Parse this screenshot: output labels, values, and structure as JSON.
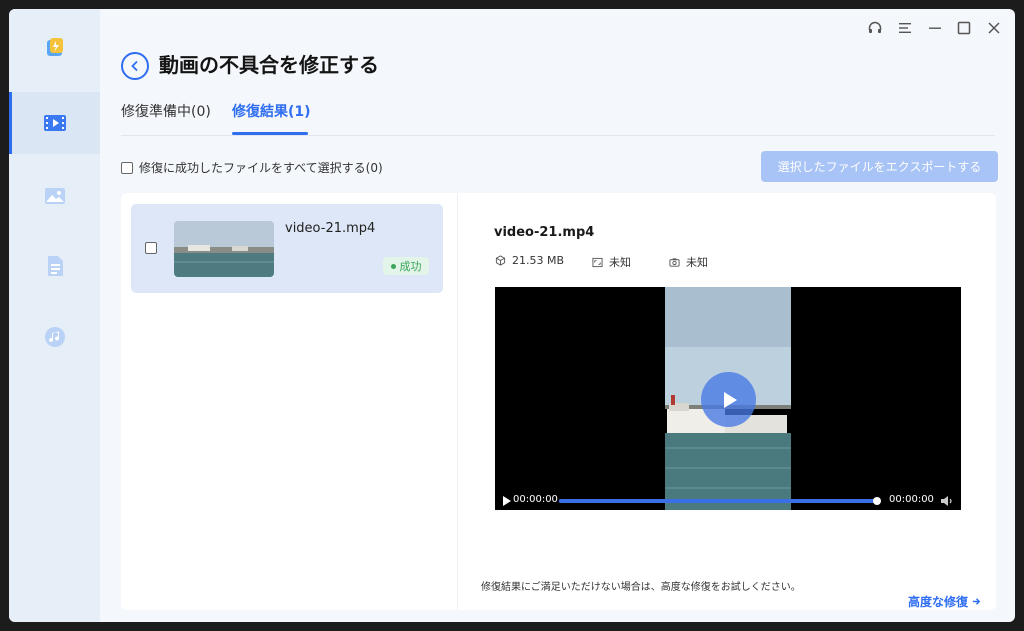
{
  "header": {
    "title": "動画の不具合を修正する"
  },
  "tabs": [
    {
      "label": "修復準備中(0)"
    },
    {
      "label": "修復結果(1)"
    }
  ],
  "toolbar": {
    "select_all_label": "修復に成功したファイルをすべて選択する(0)",
    "export_label": "選択したファイルをエクスポートする"
  },
  "files": [
    {
      "name": "video-21.mp4",
      "status": "成功"
    }
  ],
  "preview": {
    "title": "video-21.mp4",
    "size": "21.53 MB",
    "resolution": "未知",
    "camera": "未知",
    "time_current": "00:00:00",
    "time_total": "00:00:00",
    "progress": 1.0
  },
  "footer": {
    "hint": "修復結果にご満足いただけない場合は、高度な修復をお試しください。",
    "advanced_link": "高度な修復"
  },
  "colors": {
    "accent": "#2f6ef0",
    "success": "#3aa55a",
    "export_disabled": "#a8c3f6"
  },
  "icons": {
    "sidebar": [
      "app-logo-icon",
      "video-icon",
      "photo-icon",
      "document-icon",
      "audio-icon"
    ],
    "window": [
      "headset-icon",
      "menu-icon",
      "minimize-icon",
      "maximize-icon",
      "close-icon"
    ]
  }
}
